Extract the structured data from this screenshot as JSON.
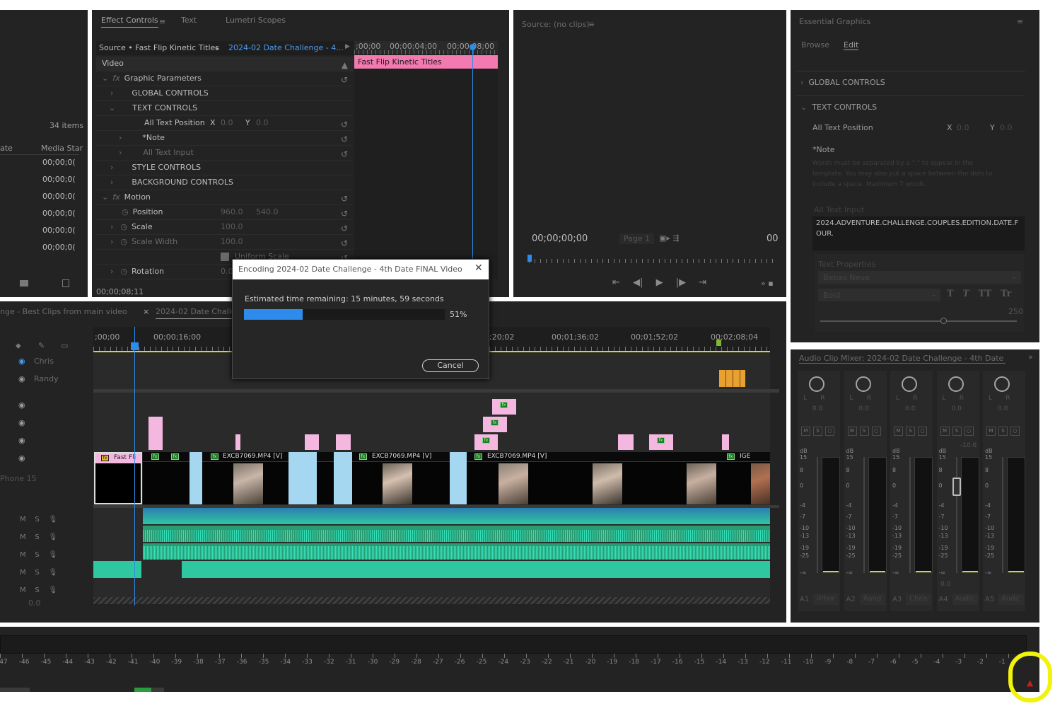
{
  "effect_controls": {
    "tabs": [
      "Effect Controls",
      "Text",
      "Lumetri Scopes"
    ],
    "source_label": "Source • Fast Flip Kinetic Titles",
    "sequence_label": "2024-02 Date Challenge - 4...",
    "ruler_times": [
      ";00;00",
      "00;00;04;00",
      "00;00;08;00"
    ],
    "clip_bar_label": "Fast Flip Kinetic Titles",
    "video_label": "Video",
    "rows": {
      "graphic_parameters": "Graphic Parameters",
      "global_controls": "GLOBAL CONTROLS",
      "text_controls": "TEXT CONTROLS",
      "all_text_position": "All Text Position",
      "x_label": "X",
      "x_value": "0.0",
      "y_label": "Y",
      "y_value": "0.0",
      "note": "*Note",
      "all_text_input": "All Text Input",
      "style_controls": "STYLE CONTROLS",
      "background_controls": "BACKGROUND CONTROLS",
      "motion": "Motion",
      "position": "Position",
      "position_x": "960.0",
      "position_y": "540.0",
      "scale": "Scale",
      "scale_value": "100.0",
      "scale_width": "Scale Width",
      "scale_width_value": "100.0",
      "uniform_scale": "Uniform Scale",
      "rotation": "Rotation",
      "rotation_value": "0.0"
    },
    "timecode": "00;00;08;11"
  },
  "project": {
    "items_count": "34 items",
    "columns": [
      "ate",
      "Media Star"
    ],
    "rows": [
      "00;00;0(",
      "00;00;0(",
      "00;00;0(",
      "00;00;0(",
      "00;00;0(",
      "00;00;0("
    ]
  },
  "source_monitor": {
    "title": "Source: (no clips)",
    "timecode": "00;00;00;00",
    "page": "Page 1",
    "right_code": "00"
  },
  "essential_graphics": {
    "title": "Essential Graphics",
    "tabs": [
      "Browse",
      "Edit"
    ],
    "global_controls": "GLOBAL CONTROLS",
    "text_controls": "TEXT CONTROLS",
    "all_text_position": "All Text Position",
    "x_label": "X",
    "x_value": "0.0",
    "y_label": "Y",
    "y_value": "0.0",
    "note_label": "*Note",
    "note_text": "Words must be separated by a \".\" to appear in the template. You may also put a space between the dots to include a space. Maximum 7 words.",
    "all_text_input_label": "All Text Input",
    "all_text_input_value": "2024.ADVENTURE.CHALLENGE.COUPLES.EDITION.DATE.FOUR.",
    "text_properties": "Text Properties",
    "font": "Bebas Neue",
    "weight": "Bold",
    "size_value": "250"
  },
  "timeline": {
    "tabs": [
      "nge - Best Clips from main video",
      "2024-02 Date Challen"
    ],
    "ruler_times": [
      ";00;00",
      "00;00;16;00",
      ";20;02",
      "00;01;36;02",
      "00;01;52;02",
      "00;02;08;04"
    ],
    "track_names": [
      "Chris",
      "Randy"
    ],
    "iphone_label": "Phone 15",
    "clip_labels": [
      "Fast Fli",
      "EXCB7069.MP4 [V]",
      "EXCB7069.MP4 [V]",
      "EXCB7069.MP4 [V]",
      "IGE"
    ],
    "audio_track_letters": [
      "M",
      "S"
    ],
    "bottom_value": "0.0"
  },
  "encoding_dialog": {
    "title": "Encoding 2024-02 Date Challenge - 4th Date FINAL Video",
    "estimate": "Estimated time remaining: 15 minutes, 59 seconds",
    "progress": 0.51,
    "progress_label": "51%",
    "cancel": "Cancel"
  },
  "audio_mixer": {
    "title": "Audio Clip Mixer: 2024-02 Date Challenge - 4th Date FINAL V",
    "channels": [
      {
        "id": "A1",
        "name": "iPhor",
        "value": "0.0"
      },
      {
        "id": "A2",
        "name": "Rand",
        "value": "0.0"
      },
      {
        "id": "A3",
        "name": "Chris",
        "value": "0.0"
      },
      {
        "id": "A4",
        "name": "Audic",
        "value": "0.0"
      },
      {
        "id": "A5",
        "name": "Audic",
        "value": "0.0"
      }
    ],
    "db_label": "dB",
    "db_scale": [
      "15",
      "8",
      "0",
      "-4",
      "-7",
      "-10",
      "-13",
      "-19",
      "-25",
      "-∞"
    ],
    "fader_value_a4": "-10.6",
    "a4_bottom": "0.0",
    "pan_labels": [
      "L",
      "R"
    ]
  },
  "bottom_meter": {
    "ticks": [
      "-47",
      "-46",
      "-45",
      "-44",
      "-43",
      "-42",
      "-41",
      "-40",
      "-39",
      "-38",
      "-37",
      "-36",
      "-35",
      "-34",
      "-33",
      "-32",
      "-31",
      "-30",
      "-29",
      "-28",
      "-27",
      "-26",
      "-25",
      "-24",
      "-23",
      "-22",
      "-21",
      "-20",
      "-19",
      "-18",
      "-17",
      "-16",
      "-15",
      "-14",
      "-13",
      "-12",
      "-11",
      "-10",
      "-9",
      "-8",
      "-7",
      "-6",
      "-5",
      "-4",
      "-3",
      "-2",
      "-1"
    ]
  },
  "colors": {
    "panel_bg": "#232323",
    "accent_blue": "#2d8ceb",
    "title_pink": "#f37ab0",
    "video_clip": "#a6d7f0",
    "audio_green": "#2fc7a0",
    "highlight_yellow": "#f2f20a"
  }
}
